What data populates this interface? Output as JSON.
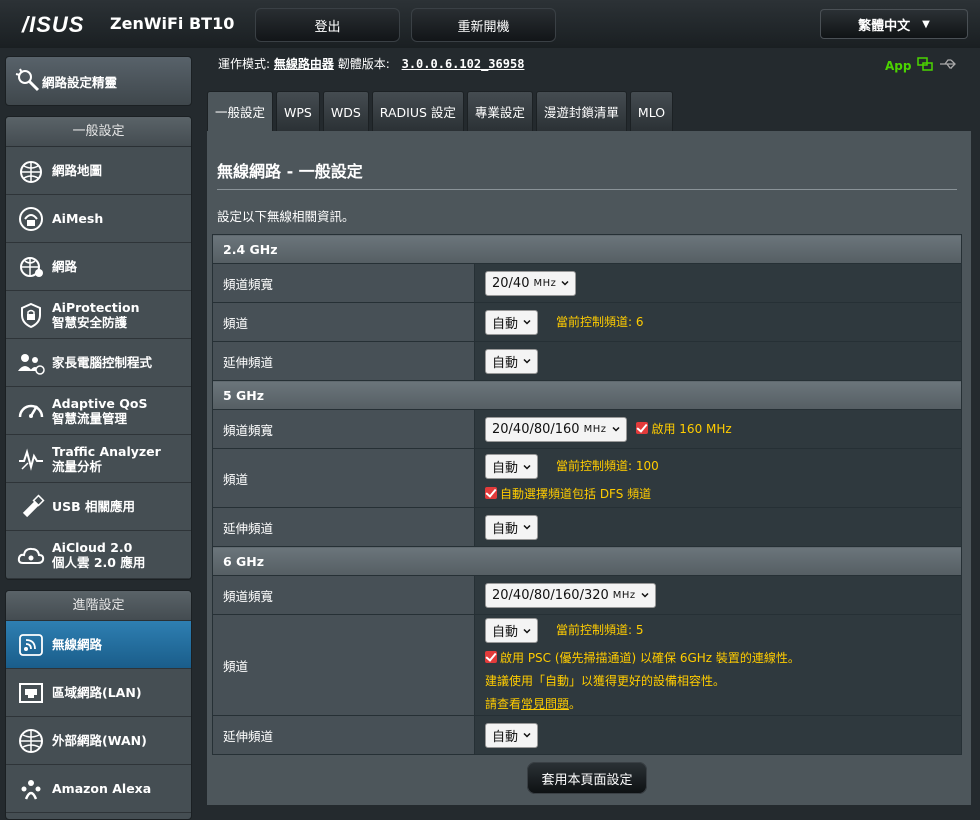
{
  "header": {
    "logo": "/ISUS",
    "product": "ZenWiFi BT10",
    "logout_label": "登出",
    "reboot_label": "重新開機",
    "language": "繁體中文"
  },
  "sidebar": {
    "wizard_label": "網路設定精靈",
    "general_header": "一般設定",
    "general_items": [
      {
        "label": "網路地圖",
        "icon": "network-map-icon"
      },
      {
        "label": "AiMesh",
        "icon": "aimesh-icon"
      },
      {
        "label": "網路",
        "icon": "globe-network-icon"
      },
      {
        "label": "AiProtection",
        "sub": "智慧安全防護",
        "icon": "shield-lock-icon"
      },
      {
        "label": "家長電腦控制程式",
        "icon": "parental-control-icon"
      },
      {
        "label": "Adaptive QoS",
        "sub": "智慧流量管理",
        "icon": "speedometer-icon"
      },
      {
        "label": "Traffic Analyzer",
        "sub": "流量分析",
        "icon": "traffic-analyzer-icon"
      },
      {
        "label": "USB 相關應用",
        "icon": "usb-icon"
      },
      {
        "label": "AiCloud 2.0",
        "sub": "個人雲 2.0 應用",
        "icon": "cloud-icon"
      }
    ],
    "advanced_header": "進階設定",
    "advanced_items": [
      {
        "label": "無線網路",
        "icon": "wireless-icon",
        "active": true
      },
      {
        "label": "區域網路(LAN)",
        "icon": "lan-icon"
      },
      {
        "label": "外部網路(WAN)",
        "icon": "wan-globe-icon"
      },
      {
        "label": "Amazon Alexa",
        "icon": "alexa-icon"
      }
    ]
  },
  "info": {
    "mode_label": "運作模式:",
    "mode_value": "無線路由器",
    "fw_label": "韌體版本:",
    "fw_value": "3.0.0.6.102_36958",
    "app_label": "App"
  },
  "tabs": [
    "一般設定",
    "WPS",
    "WDS",
    "RADIUS 設定",
    "專業設定",
    "漫遊封鎖清單",
    "MLO"
  ],
  "panel": {
    "title": "無線網路 - 一般設定",
    "description": "設定以下無線相關資訊。",
    "band_24": {
      "header": "2.4 GHz",
      "bw_label": "頻道頻寬",
      "bw_value": "20/40",
      "bw_unit": "MHz",
      "ch_label": "頻道",
      "ch_value": "自動",
      "ch_current": "當前控制頻道: 6",
      "ext_label": "延伸頻道",
      "ext_value": "自動"
    },
    "band_5": {
      "header": "5 GHz",
      "bw_label": "頻道頻寬",
      "bw_value": "20/40/80/160",
      "bw_unit": "MHz",
      "bw_check": "啟用 160 MHz",
      "ch_label": "頻道",
      "ch_value": "自動",
      "ch_current": "當前控制頻道: 100",
      "dfs_check": "自動選擇頻道包括 DFS 頻道",
      "ext_label": "延伸頻道",
      "ext_value": "自動"
    },
    "band_6": {
      "header": "6 GHz",
      "bw_label": "頻道頻寬",
      "bw_value": "20/40/80/160/320",
      "bw_unit": "MHz",
      "ch_label": "頻道",
      "ch_value": "自動",
      "ch_current": "當前控制頻道: 5",
      "psc_check": "啟用 PSC (優先掃描通道) 以確保 6GHz 裝置的連線性。",
      "hint1": "建議使用「自動」以獲得更好的設備相容性。",
      "hint2_prefix": "請查看",
      "hint2_link": "常見問題",
      "hint2_suffix": "。",
      "ext_label": "延伸頻道",
      "ext_value": "自動"
    },
    "apply_label": "套用本頁面設定"
  }
}
